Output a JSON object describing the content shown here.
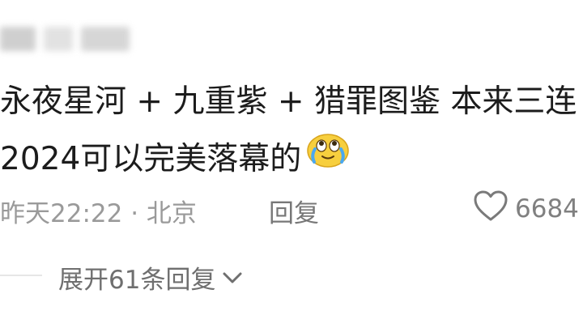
{
  "comment": {
    "line1": "永夜星河 + 九重紫 + 猎罪图鉴 本来三连",
    "line2": "2024可以完美落幕的",
    "emoji": "crying-laughing-face-icon"
  },
  "meta": {
    "time_location": "昨天22:22 · 北京",
    "reply_label": "回复",
    "like_count": "6684"
  },
  "replies": {
    "expand_label": "展开61条回复"
  },
  "colors": {
    "text": "#1c1c1c",
    "meta": "#9a9a9a",
    "emoji": "#f7cf3e"
  }
}
